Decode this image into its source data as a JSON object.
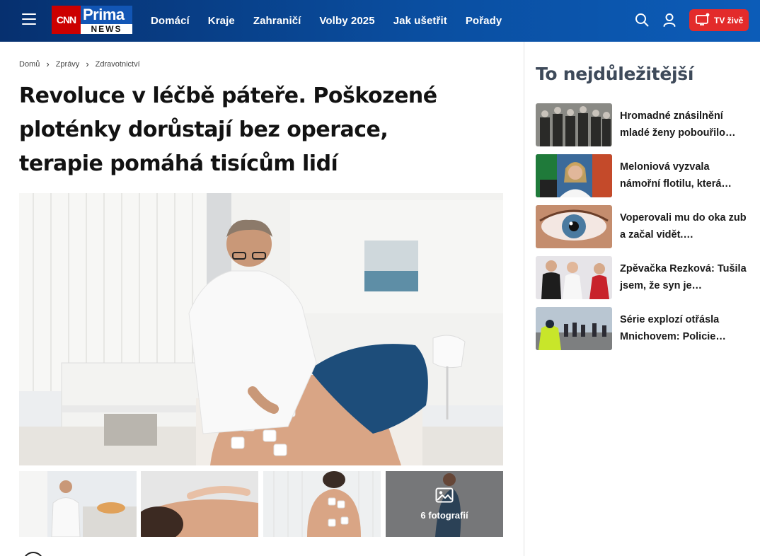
{
  "header": {
    "logo": {
      "cnn": "CNN",
      "prima": "Prima",
      "news": "NEWS"
    },
    "nav": [
      "Domácí",
      "Kraje",
      "Zahraničí",
      "Volby 2025",
      "Jak ušetřit",
      "Pořady"
    ],
    "icons": {
      "menu": "hamburger-icon",
      "search": "search-icon",
      "user": "user-icon",
      "tv": "tv-icon"
    },
    "tv_label": "TV živě",
    "colors": {
      "bar": "#0a4ea0",
      "tv_button": "#e32b2b",
      "cnn_red": "#cc0000"
    }
  },
  "breadcrumb": [
    "Domů",
    "Zprávy",
    "Zdravotnictví"
  ],
  "article": {
    "title": "Revoluce v léčbě páteře. Poškozené ploténky dorůstají bez operace, terapie pomáhá tisícům lidí",
    "gallery_count": "6 fotografií"
  },
  "sidebar": {
    "title": "To nejdůležitější",
    "items": [
      {
        "text": "Hromadné znásilnění mladé ženy pobouřilo…"
      },
      {
        "text": "Meloniová vyzvala námořní flotilu, která…"
      },
      {
        "text": "Voperovali mu do oka zub a začal vidět.…"
      },
      {
        "text": "Zpěvačka Rezková: Tušila jsem, že syn je…"
      },
      {
        "text": "Série explozí otřásla Mnichovem: Policie…"
      }
    ]
  }
}
